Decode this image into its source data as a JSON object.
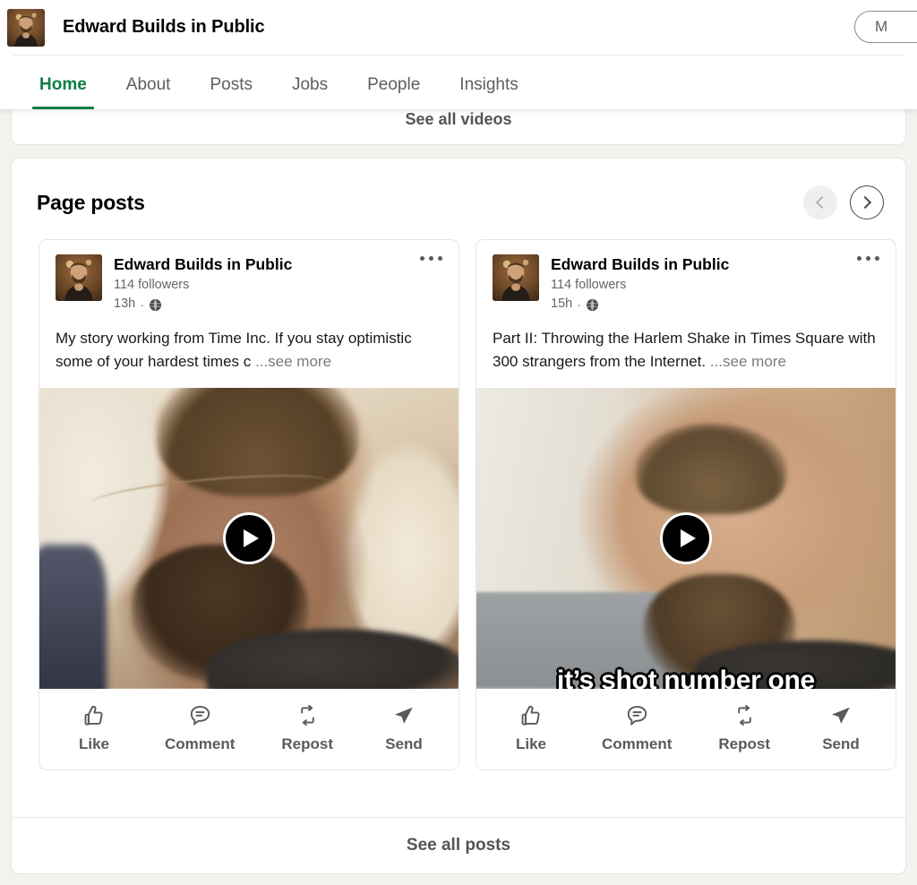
{
  "header": {
    "title": "Edward Builds in Public",
    "avatar_alt": "profile-photo",
    "action_button_label": "M",
    "tabs": [
      {
        "label": "Home",
        "active": true
      },
      {
        "label": "About",
        "active": false
      },
      {
        "label": "Posts",
        "active": false
      },
      {
        "label": "Jobs",
        "active": false
      },
      {
        "label": "People",
        "active": false
      },
      {
        "label": "Insights",
        "active": false
      }
    ],
    "active_tab_color": "#0a7d45"
  },
  "videos_card": {
    "see_all_label": "See all videos"
  },
  "page_posts": {
    "title": "Page posts",
    "prev_label": "‹",
    "next_label": "›",
    "see_all_label": "See all posts",
    "posts": [
      {
        "author": "Edward Builds in Public",
        "followers": "114 followers",
        "time": "13h",
        "separator": "·",
        "visibility_icon": "globe-icon",
        "text": "My story working from Time Inc. If you stay optimistic some of your hardest times c",
        "see_more": "...see more",
        "video_caption": "",
        "actions": [
          {
            "label": "Like",
            "icon": "thumbs-up-icon"
          },
          {
            "label": "Comment",
            "icon": "comment-bubble-icon"
          },
          {
            "label": "Repost",
            "icon": "repost-icon"
          },
          {
            "label": "Send",
            "icon": "send-paper-plane-icon"
          }
        ]
      },
      {
        "author": "Edward Builds in Public",
        "followers": "114 followers",
        "time": "15h",
        "separator": "·",
        "visibility_icon": "globe-icon",
        "text": "Part II: Throwing the Harlem Shake in Times Square with 300 strangers from the Internet.",
        "see_more": "...see more",
        "video_caption": "it’s shot number one",
        "actions": [
          {
            "label": "Like",
            "icon": "thumbs-up-icon"
          },
          {
            "label": "Comment",
            "icon": "comment-bubble-icon"
          },
          {
            "label": "Repost",
            "icon": "repost-icon"
          },
          {
            "label": "Send",
            "icon": "send-paper-plane-icon"
          }
        ]
      }
    ]
  },
  "theme": {
    "page_bg": "#f4f2ee",
    "card_bg": "#ffffff",
    "accent_green": "#0a7d45",
    "muted_text": "#666666"
  }
}
